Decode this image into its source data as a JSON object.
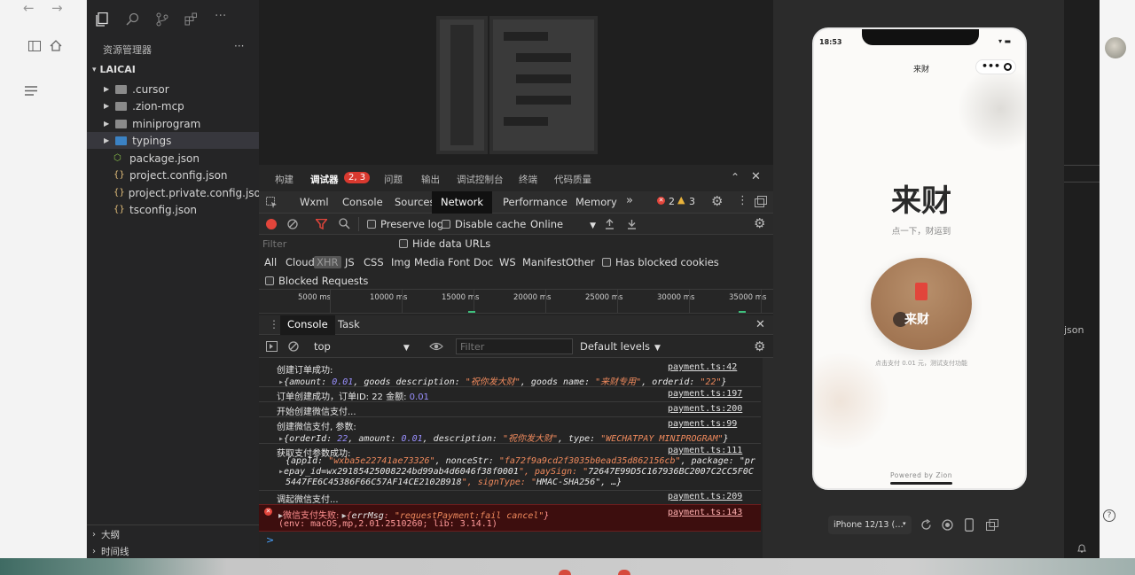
{
  "browser": {
    "right_label": "json"
  },
  "activity_bar": {
    "icons": [
      "files-icon",
      "search-icon",
      "source-control-icon",
      "extensions-icon",
      "more-icon"
    ]
  },
  "explorer": {
    "title": "资源管理器",
    "more": "···",
    "project": "LAICAI",
    "items": [
      {
        "label": ".cursor",
        "type": "folder"
      },
      {
        "label": ".zion-mcp",
        "type": "folder"
      },
      {
        "label": "miniprogram",
        "type": "folder"
      },
      {
        "label": "typings",
        "type": "folder-ts"
      },
      {
        "label": "package.json",
        "type": "npm"
      },
      {
        "label": "project.config.json",
        "type": "json"
      },
      {
        "label": "project.private.config.json",
        "type": "json"
      },
      {
        "label": "tsconfig.json",
        "type": "json"
      }
    ],
    "outline": "大纲",
    "timeline": "时间线"
  },
  "devtools": {
    "tabs": [
      "构建",
      "调试器",
      "问题",
      "输出",
      "调试控制台",
      "终端",
      "代码质量"
    ],
    "debugger_badge": "2, 3",
    "panel_tabs": [
      "Wxml",
      "Console",
      "Sources",
      "Network",
      "Performance",
      "Memory"
    ],
    "more_tabs": "»",
    "error_count": "2",
    "warn_count": "3",
    "network": {
      "preserve_log": "Preserve log",
      "disable_cache": "Disable cache",
      "throttle": "Online",
      "filter_placeholder": "Filter",
      "hide_data_urls": "Hide data URLs",
      "types": [
        "All",
        "Cloud",
        "XHR",
        "JS",
        "CSS",
        "Img",
        "Media",
        "Font",
        "Doc",
        "WS",
        "Manifest",
        "Other"
      ],
      "has_blocked": "Has blocked cookies",
      "blocked_requests": "Blocked Requests",
      "timeline": [
        "5000 ms",
        "10000 ms",
        "15000 ms",
        "20000 ms",
        "25000 ms",
        "30000 ms",
        "35000 ms"
      ]
    },
    "drawer_tabs": [
      "Console",
      "Task"
    ],
    "console": {
      "context": "top",
      "filter_placeholder": "Filter",
      "levels": "Default levels",
      "logs": [
        {
          "text": "创建订单成功:",
          "src": "payment.ts:42"
        },
        {
          "obj": "{amount: 0.01, goods_description: \"祝你发大财\", goods_name: \"来财专用\", orderid: \"22\"}"
        },
        {
          "text": "订单创建成功，订单ID: 22 金额: 0.01",
          "src": "payment.ts:197"
        },
        {
          "text": "开始创建微信支付...",
          "src": "payment.ts:200"
        },
        {
          "text": "创建微信支付, 参数:",
          "src": "payment.ts:99"
        },
        {
          "obj": "{orderId: 22, amount: 0.01, description: \"祝你发大财\", type: \"WECHATPAY_MINIPROGRAM\"}"
        },
        {
          "text": "获取支付参数成功:",
          "src": "payment.ts:111"
        },
        {
          "obj": "{appId: \"wxba5e22741ae73326\", nonceStr: \"fa72f9a9cd2f3035b0ead35d862156cb\", package: \"pr"
        },
        {
          "obj": "epay_id=wx29185425008224bd99ab4d6046f38f0001\", paySign: \"72647E99D5C167936BC2007C2CC5F0C"
        },
        {
          "obj": "5447FE6C45386F66C57AF14CE2102B918\", signType: \"HMAC-SHA256\", …}"
        },
        {
          "text": "调起微信支付...",
          "src": "payment.ts:209"
        },
        {
          "text": "微信支付失败:",
          "obj": "{errMsg: \"requestPayment:fail cancel\"}",
          "src": "payment.ts:143"
        },
        {
          "text": "(env: macOS,mp,2.01.2510260; lib: 3.14.1)"
        }
      ],
      "prompt": ">"
    }
  },
  "phone": {
    "time": "18:53",
    "title": "来财",
    "heading": "来财",
    "subtitle": "点一下，财运到",
    "button_label": "来财",
    "hint": "点击支付 0.01 元，测试支付功能",
    "footer": "Powered by Zion"
  },
  "simulator": {
    "device": "iPhone 12/13 (…",
    "dropdown": "▾"
  },
  "colors": {
    "accent_red": "#e2453b",
    "button_brown": "#a67b55",
    "warn": "#e9b33b"
  }
}
